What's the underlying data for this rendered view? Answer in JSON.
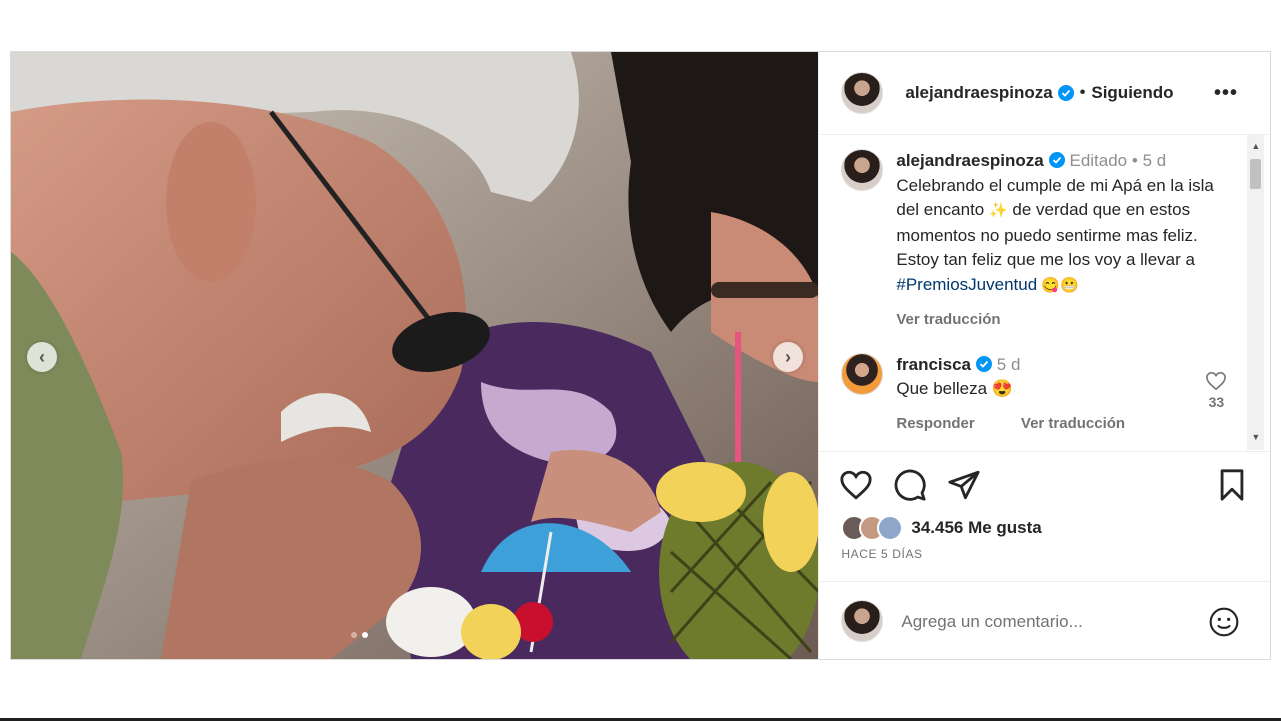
{
  "post": {
    "username": "alejandraespinoza",
    "follow_separator": "•",
    "follow_state": "Siguiendo",
    "more_label": "•••"
  },
  "carousel": {
    "prev_glyph": "‹",
    "next_glyph": "›",
    "current_index": 2,
    "total": 2
  },
  "caption": {
    "username": "alejandraespinoza",
    "edited_label": "Editado",
    "dot": "•",
    "time": "5 d",
    "text_start": "Celebrando el cumple de mi Apá en la isla del encanto ",
    "emoji_sparkle": "✨",
    "text_mid": " de verdad que en estos momentos no puedo sentirme mas feliz. Estoy tan feliz que me los voy a llevar a ",
    "hashtag": "#PremiosJuventud",
    "emoji_end": " 😋😬",
    "translate_label": "Ver traducción"
  },
  "comment": {
    "username": "francisca",
    "time": "5 d",
    "text": "Que belleza 😍",
    "reply_label": "Responder",
    "translate_label": "Ver traducción",
    "like_count": "33"
  },
  "engagement": {
    "likes": "34.456 Me gusta",
    "time_ago": "HACE 5 DÍAS"
  },
  "composer": {
    "placeholder": "Agrega un comentario..."
  },
  "colors": {
    "verified": "#0095f6",
    "hashtag": "#00376b",
    "muted": "#737373"
  }
}
